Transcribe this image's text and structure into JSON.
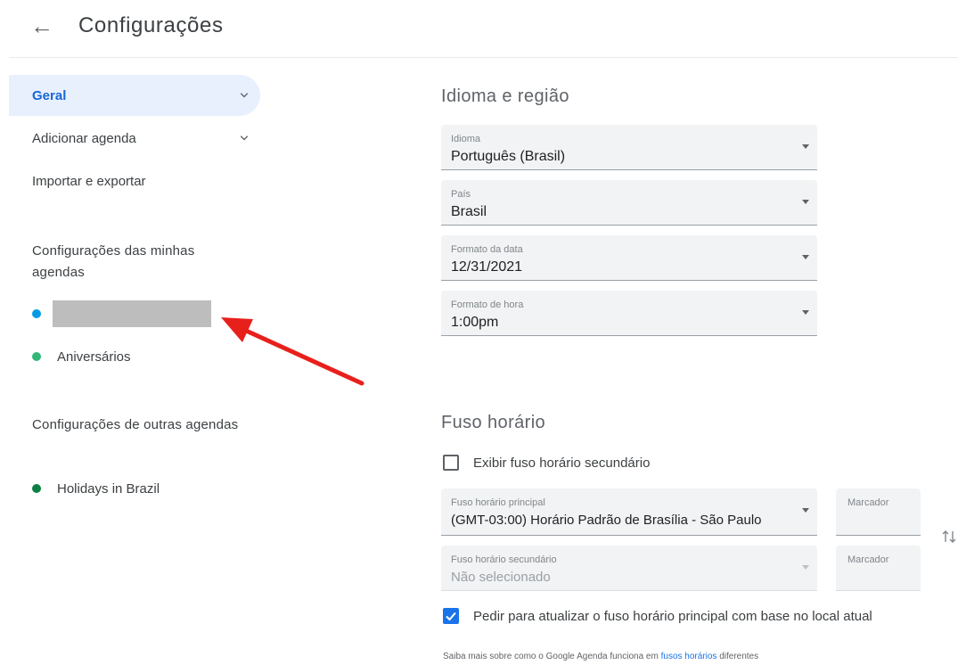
{
  "header": {
    "back_icon": "arrow-left-icon",
    "title": "Configurações"
  },
  "sidebar": {
    "items": [
      {
        "label": "Geral"
      },
      {
        "label": "Adicionar agenda"
      },
      {
        "label": "Importar e exportar"
      }
    ],
    "my_calendars_heading": "Configurações das minhas agendas",
    "my_calendars": [
      {
        "label": "",
        "color": "#039be5"
      },
      {
        "label": "Aniversários",
        "color": "#33b679"
      }
    ],
    "other_calendars_heading": "Configurações de outras agendas",
    "other_calendars": [
      {
        "label": "Holidays in Brazil",
        "color": "#0b8043"
      }
    ]
  },
  "region": {
    "title": "Idioma e região",
    "idioma": {
      "caption": "Idioma",
      "value": "Português (Brasil)"
    },
    "pais": {
      "caption": "País",
      "value": "Brasil"
    },
    "formato_data": {
      "caption": "Formato da data",
      "value": "12/31/2021"
    },
    "formato_hora": {
      "caption": "Formato de hora",
      "value": "1:00pm"
    }
  },
  "timezone": {
    "title": "Fuso horário",
    "show_secondary": {
      "label": "Exibir fuso horário secundário",
      "checked": false
    },
    "primary": {
      "caption": "Fuso horário principal",
      "value": "(GMT-03:00) Horário Padrão de Brasília - São Paulo"
    },
    "secondary": {
      "caption": "Fuso horário secundário",
      "value": "Não selecionado"
    },
    "marcador_label": "Marcador",
    "ask_update": {
      "label": "Pedir para atualizar o fuso horário principal com base no local atual",
      "checked": true
    },
    "footer_text": "Saiba mais sobre como o Google Agenda funciona em ",
    "footer_link": "fusos horários",
    "footer_text_after": " diferentes"
  },
  "colors": {
    "accent": "#1a73e8",
    "selected_bg": "#e8f0fe",
    "annotation_arrow": "#e8201c"
  }
}
